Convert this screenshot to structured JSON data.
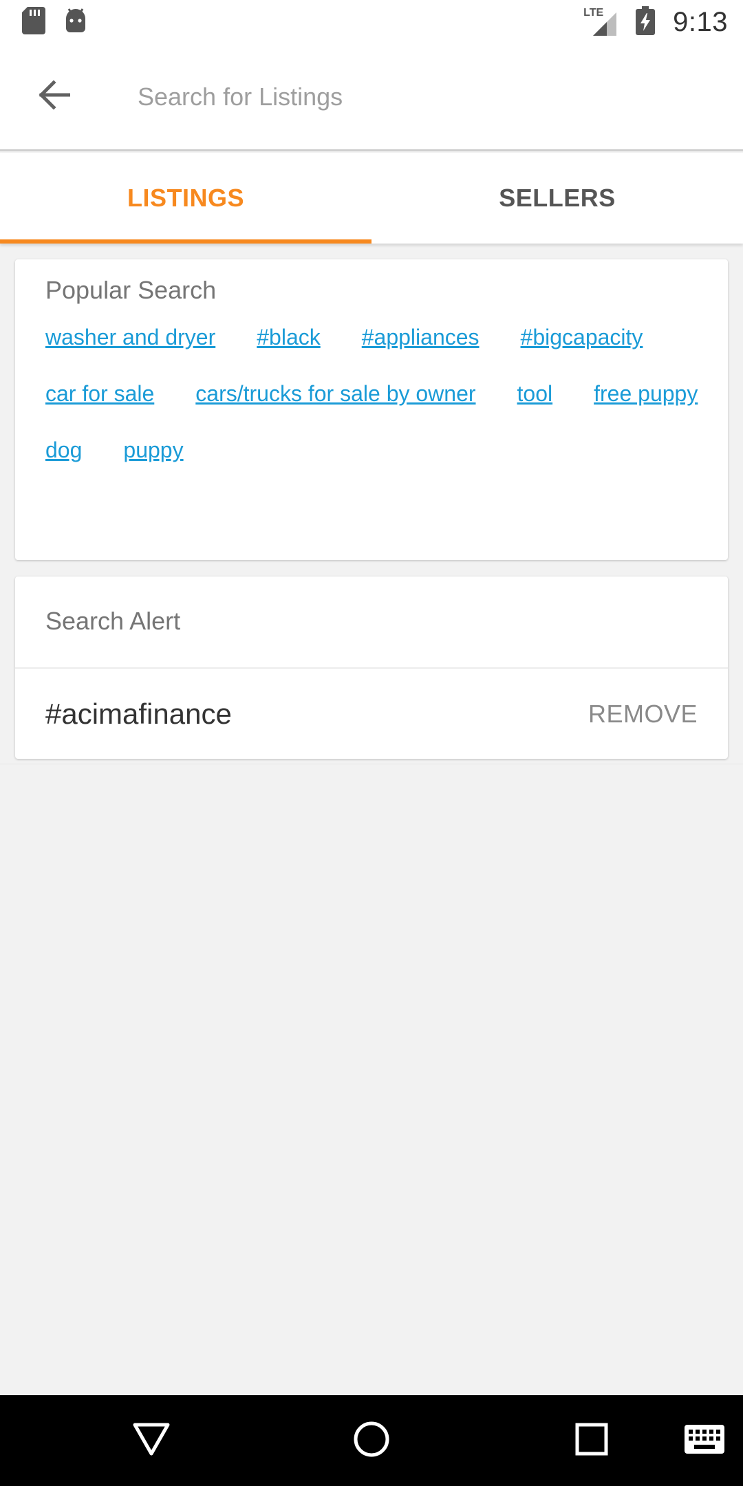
{
  "status_bar": {
    "time": "9:13",
    "network": "LTE",
    "icons": [
      "sd-card-icon",
      "android-icon",
      "lte-signal-icon",
      "battery-charging-icon"
    ]
  },
  "app_bar": {
    "back_icon": "arrow-left-icon",
    "search_placeholder": "Search for Listings",
    "search_value": ""
  },
  "tabs": [
    {
      "label": "LISTINGS",
      "active": true
    },
    {
      "label": "SELLERS",
      "active": false
    }
  ],
  "popular_search": {
    "title": "Popular Search",
    "tags": [
      "washer and dryer",
      "#black",
      "#appliances",
      "#bigcapacity",
      "car for sale",
      "cars/trucks for sale by owner",
      "tool",
      "free puppy",
      "dog",
      "puppy"
    ]
  },
  "search_alert": {
    "title": "Search Alert",
    "items": [
      {
        "term": "#acimafinance",
        "action": "REMOVE"
      }
    ]
  },
  "nav_bar": {
    "icons": [
      "back-triangle-icon",
      "home-circle-icon",
      "recents-square-icon",
      "keyboard-icon"
    ]
  },
  "colors": {
    "accent": "#f7891f",
    "link": "#1a9bd7",
    "background": "#f2f2f2"
  }
}
